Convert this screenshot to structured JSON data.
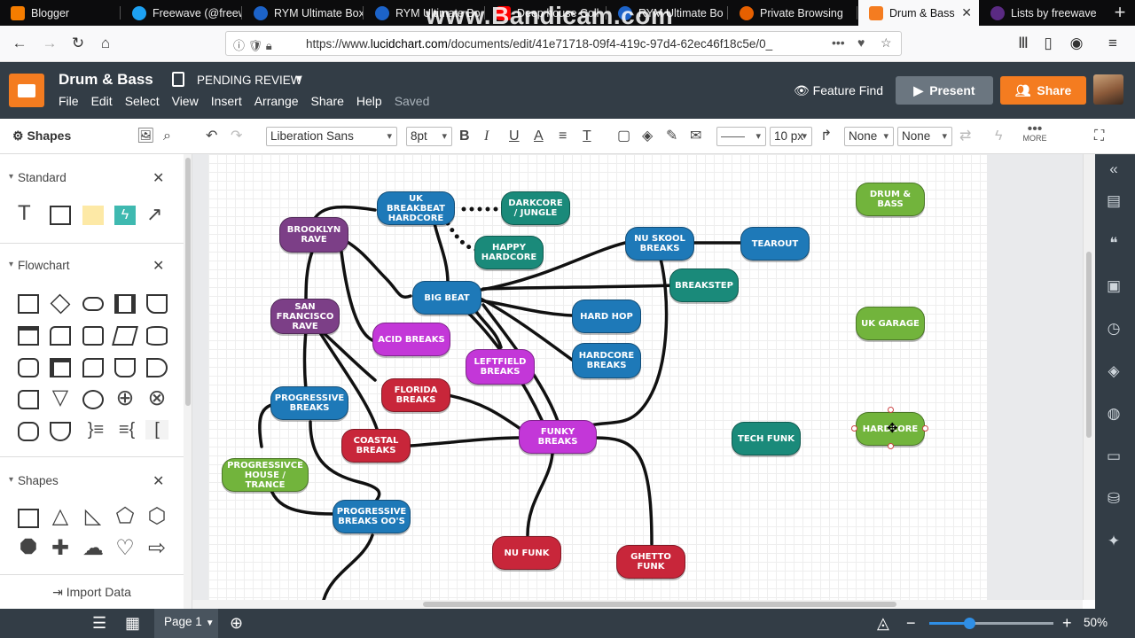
{
  "browser": {
    "tabs": [
      {
        "label": "Blogger",
        "color": "#f57d00"
      },
      {
        "label": "Freewave (@freew",
        "color": "#1da1f2"
      },
      {
        "label": "RYM Ultimate Box",
        "color": "#1c63c9"
      },
      {
        "label": "RYM Ultimate Bo",
        "color": "#1c63c9"
      },
      {
        "label": "Deep house Coll",
        "color": "#ff0000"
      },
      {
        "label": "RYM Ultimate Bo",
        "color": "#1c63c9"
      },
      {
        "label": "Private Browsing",
        "color": "#e66000"
      },
      {
        "label": "Drum & Bass",
        "color": "#f47c20"
      },
      {
        "label": "Lists by freewave",
        "color": "#5a2a82"
      }
    ],
    "watermark": "www.Bandicam.com",
    "url_prefix": "https://www.",
    "url_domain": "lucidchart.com",
    "url_path": "/documents/edit/41e71718-09f4-419c-97d4-62ec46f18c5e/0_"
  },
  "app": {
    "title": "Drum & Bass",
    "status": "PENDING REVIEW",
    "menus": [
      "File",
      "Edit",
      "Select",
      "View",
      "Insert",
      "Arrange",
      "Share",
      "Help"
    ],
    "saved": "Saved",
    "feature_find": "Feature Find",
    "present": "Present",
    "share": "Share",
    "accent": "#f47c20"
  },
  "toolbar": {
    "shapes_label": "Shapes",
    "font": "Liberation Sans",
    "font_size": "8pt",
    "line_width": "10 px",
    "arrow_start": "None",
    "arrow_end": "None",
    "more": "MORE"
  },
  "left_panel": {
    "standard": "Standard",
    "flowchart": "Flowchart",
    "shapes": "Shapes",
    "import_data": "Import Data"
  },
  "diagram": {
    "nodes": [
      {
        "id": "uk_breakbeat",
        "label": "UK BREAKBEAT HARDCORE",
        "color": "blue"
      },
      {
        "id": "darkcore",
        "label": "DARKCORE / JUNGLE",
        "color": "teal"
      },
      {
        "id": "happy_hardcore",
        "label": "HAPPY HARDCORE",
        "color": "teal"
      },
      {
        "id": "brooklyn",
        "label": "BROOKLYN RAVE",
        "color": "purple"
      },
      {
        "id": "nu_skool",
        "label": "NU SKOOL BREAKS",
        "color": "blue"
      },
      {
        "id": "tearout",
        "label": "TEAROUT",
        "color": "blue"
      },
      {
        "id": "drum_bass",
        "label": "DRUM & BASS",
        "color": "green"
      },
      {
        "id": "breakstep",
        "label": "BREAKSTEP",
        "color": "teal"
      },
      {
        "id": "big_beat",
        "label": "BIG BEAT",
        "color": "blue"
      },
      {
        "id": "sf_rave",
        "label": "SAN FRANCISCO RAVE",
        "color": "purple"
      },
      {
        "id": "hard_hop",
        "label": "HARD HOP",
        "color": "blue"
      },
      {
        "id": "uk_garage",
        "label": "UK GARAGE",
        "color": "green"
      },
      {
        "id": "acid_breaks",
        "label": "ACID BREAKS",
        "color": "magenta"
      },
      {
        "id": "hardcore_breaks",
        "label": "HARDCORE BREAKS",
        "color": "blue"
      },
      {
        "id": "leftfield",
        "label": "LEFTFIELD BREAKS",
        "color": "magenta"
      },
      {
        "id": "florida",
        "label": "FLORIDA BREAKS",
        "color": "red"
      },
      {
        "id": "prog_breaks",
        "label": "PROGRESSIVE BREAKS",
        "color": "blue"
      },
      {
        "id": "hardcore",
        "label": "HARDCORE",
        "color": "green"
      },
      {
        "id": "coastal",
        "label": "COASTAL BREAKS",
        "color": "red"
      },
      {
        "id": "funky",
        "label": "FUNKY BREAKS",
        "color": "magenta"
      },
      {
        "id": "tech_funk",
        "label": "TECH FUNK",
        "color": "teal"
      },
      {
        "id": "prog_house",
        "label": "PROGRESSIVCE HOUSE / TRANCE",
        "color": "green"
      },
      {
        "id": "prog_breaks_00",
        "label": "PROGRESSIVE BREAKS OO'S",
        "color": "blue"
      },
      {
        "id": "nu_funk",
        "label": "NU FUNK",
        "color": "red"
      },
      {
        "id": "ghetto_funk",
        "label": "GHETTO FUNK",
        "color": "red"
      }
    ]
  },
  "bottom": {
    "page": "Page 1",
    "zoom": "50%",
    "zoom_level": 0.32
  }
}
